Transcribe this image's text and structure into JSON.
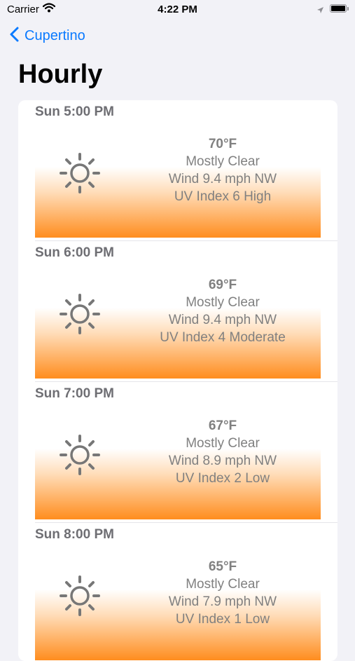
{
  "status_bar": {
    "carrier": "Carrier",
    "time": "4:22 PM"
  },
  "nav": {
    "back_label": "Cupertino",
    "title": "Hourly"
  },
  "colors": {
    "accent": "#0a7aff",
    "gradient": "#ff8d1e",
    "secondary_text": "#808080"
  },
  "hours": [
    {
      "time": "Sun 5:00 PM",
      "icon": "sun-icon",
      "temp": "70°F",
      "condition": "Mostly Clear",
      "wind": "Wind 9.4 mph NW",
      "uv": "UV Index 6 High"
    },
    {
      "time": "Sun 6:00 PM",
      "icon": "sun-icon",
      "temp": "69°F",
      "condition": "Mostly Clear",
      "wind": "Wind 9.4 mph NW",
      "uv": "UV Index 4 Moderate"
    },
    {
      "time": "Sun 7:00 PM",
      "icon": "sun-icon",
      "temp": "67°F",
      "condition": "Mostly Clear",
      "wind": "Wind 8.9 mph NW",
      "uv": "UV Index 2 Low"
    },
    {
      "time": "Sun 8:00 PM",
      "icon": "sun-icon",
      "temp": "65°F",
      "condition": "Mostly Clear",
      "wind": "Wind 7.9 mph NW",
      "uv": "UV Index 1 Low"
    }
  ]
}
